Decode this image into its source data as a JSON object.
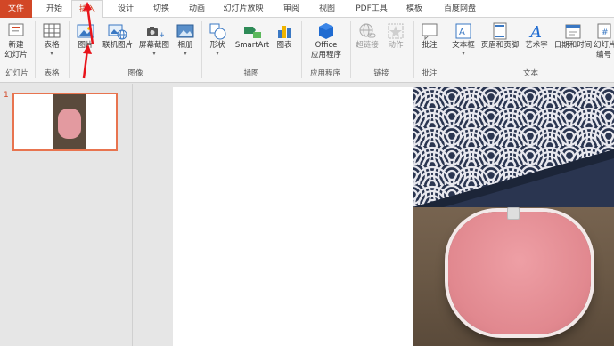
{
  "tabs": [
    {
      "label": "文件",
      "active": false,
      "kind": "file"
    },
    {
      "label": "开始",
      "active": false
    },
    {
      "label": "插入",
      "active": true
    },
    {
      "label": "设计",
      "active": false
    },
    {
      "label": "切换",
      "active": false
    },
    {
      "label": "动画",
      "active": false
    },
    {
      "label": "幻灯片放映",
      "active": false
    },
    {
      "label": "审阅",
      "active": false
    },
    {
      "label": "视图",
      "active": false
    },
    {
      "label": "PDF工具",
      "active": false
    },
    {
      "label": "模板",
      "active": false
    },
    {
      "label": "百度网盘",
      "active": false
    }
  ],
  "ribbon": {
    "slides": {
      "new_slide_1": "新建",
      "new_slide_2": "幻灯片",
      "group": "幻灯片"
    },
    "tables": {
      "table": "表格",
      "group": "表格"
    },
    "images": {
      "picture": "图片",
      "online_picture": "联机图片",
      "screenshot": "屏幕截图",
      "album": "相册",
      "group": "图像"
    },
    "illustrations": {
      "shapes": "形状",
      "smartart": "SmartArt",
      "chart": "图表",
      "group": "插图"
    },
    "apps": {
      "office_1": "Office",
      "office_2": "应用程序",
      "group": "应用程序"
    },
    "links": {
      "hyperlink": "超链接",
      "action": "动作",
      "group": "链接"
    },
    "comments": {
      "comment": "批注",
      "group": "批注"
    },
    "text": {
      "textbox": "文本框",
      "header_footer": "页眉和页脚",
      "wordart": "艺术字",
      "datetime": "日期和时间",
      "slide_number_1": "幻灯片",
      "slide_number_2": "编号",
      "group": "文本"
    }
  },
  "thumbnails": {
    "slide_number": "1"
  },
  "colors": {
    "accent": "#d24726",
    "annotation": "#e8141b",
    "selection": "#e8744f"
  }
}
